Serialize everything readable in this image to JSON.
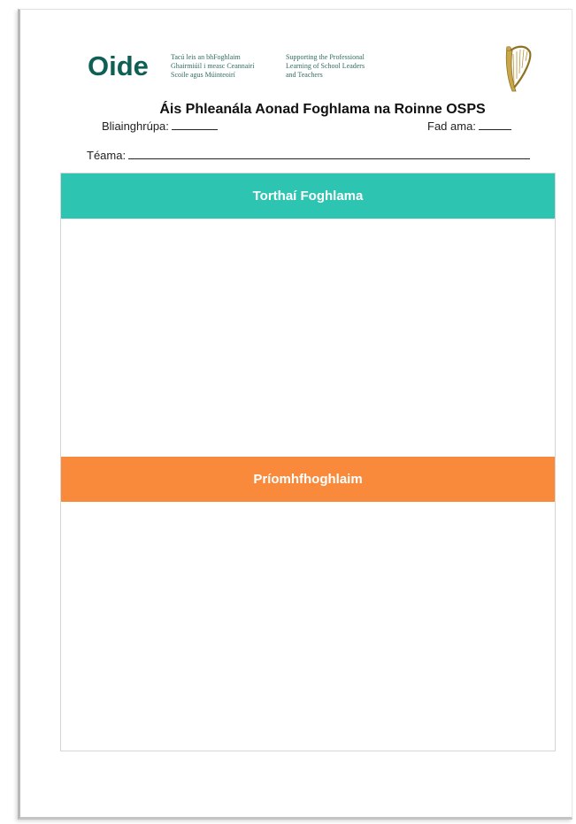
{
  "header": {
    "logo_text": "Oide",
    "tagline_irish": [
      "Tacú leis an bhFoghlaim",
      "Ghairmiúil i measc Ceannairí",
      "Scoile agus Múinteoirí"
    ],
    "tagline_english": [
      "Supporting the Professional",
      "Learning of School Leaders",
      "and Teachers"
    ],
    "crest_icon": "harp-icon"
  },
  "document": {
    "title": "Áis Phleanála Aonad Foghlama na Roinne OSPS",
    "year_group_label": "Bliainghrúpa:",
    "duration_label": "Fad ama:",
    "theme_label": "Téama:"
  },
  "sections": [
    {
      "title": "Torthaí Foghlama",
      "color": "#2ec4b2"
    },
    {
      "title": "Príomhfhoghlaim",
      "color": "#f98a3c"
    }
  ],
  "colors": {
    "logo": "#0e5f55",
    "harp": "#c9a64a"
  }
}
